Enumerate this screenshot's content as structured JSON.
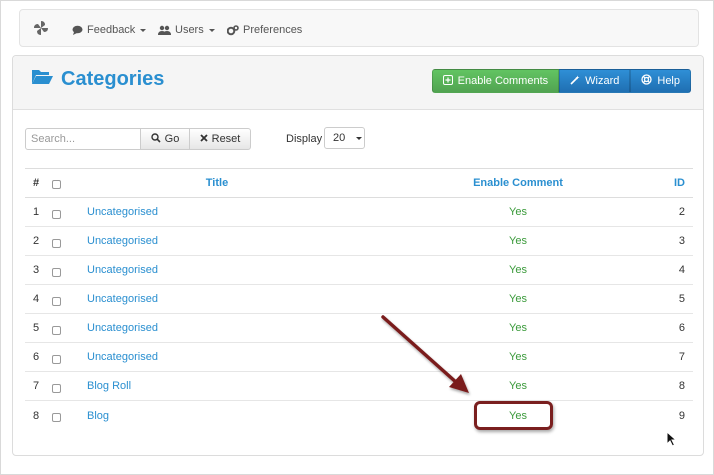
{
  "navbar": {
    "logo_icon": "pinwheel-logo-icon",
    "items": [
      {
        "label": "Feedback",
        "icon": "comment-icon"
      },
      {
        "label": "Users",
        "icon": "users-icon"
      },
      {
        "label": "Preferences",
        "icon": "gears-icon"
      }
    ]
  },
  "header": {
    "title": "Categories",
    "title_icon": "folder-open-icon",
    "buttons": [
      {
        "label": "Enable Comments",
        "icon": "plus-square-icon"
      },
      {
        "label": "Wizard",
        "icon": "magic-wand-icon"
      },
      {
        "label": "Help",
        "icon": "lifebuoy-icon"
      }
    ]
  },
  "toolbar": {
    "search_placeholder": "Search...",
    "go_label": "Go",
    "reset_label": "Reset",
    "display_label": "Display",
    "display_value": "20"
  },
  "table": {
    "columns": {
      "num": "#",
      "title": "Title",
      "enable": "Enable Comment",
      "id": "ID"
    },
    "rows": [
      {
        "num": "1",
        "title": "Uncategorised",
        "enable": "Yes",
        "id": "2"
      },
      {
        "num": "2",
        "title": "Uncategorised",
        "enable": "Yes",
        "id": "3"
      },
      {
        "num": "3",
        "title": "Uncategorised",
        "enable": "Yes",
        "id": "4"
      },
      {
        "num": "4",
        "title": "Uncategorised",
        "enable": "Yes",
        "id": "5"
      },
      {
        "num": "5",
        "title": "Uncategorised",
        "enable": "Yes",
        "id": "6"
      },
      {
        "num": "6",
        "title": "Uncategorised",
        "enable": "Yes",
        "id": "7"
      },
      {
        "num": "7",
        "title": "Blog Roll",
        "enable": "Yes",
        "id": "8"
      },
      {
        "num": "8",
        "title": "Blog",
        "enable": "Yes",
        "id": "9"
      }
    ]
  },
  "colors": {
    "accent": "#2a8fd0",
    "green_button": "#51a351",
    "blue_button": "#1f6fb2",
    "yes_text": "#3a9a3a",
    "annotation": "#7a1f1f"
  }
}
